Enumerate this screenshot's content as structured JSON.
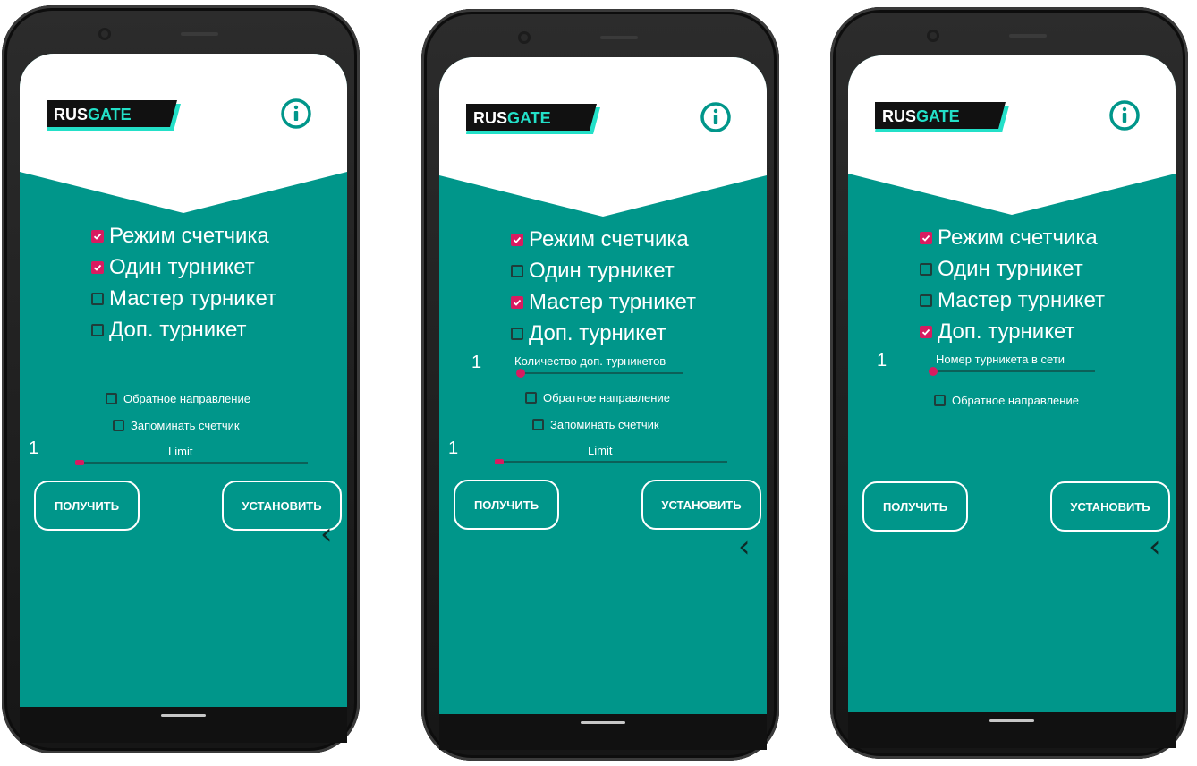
{
  "app": {
    "logo_part1": "RUS",
    "logo_part2": "GATE",
    "colors": {
      "accent": "#d81b60",
      "background": "#00968a",
      "logo_cyan": "#23e0c8"
    },
    "info_icon": "info-icon",
    "back_icon": "chevron-left-icon"
  },
  "screens": [
    {
      "modes": [
        {
          "label": "Режим счетчика",
          "checked": true
        },
        {
          "label": "Один турникет",
          "checked": true
        },
        {
          "label": "Мастер турникет",
          "checked": false
        },
        {
          "label": "Доп. турникет",
          "checked": false
        }
      ],
      "options": [
        {
          "label": "Обратное направление",
          "checked": false
        },
        {
          "label": "Запоминать счетчик",
          "checked": false
        }
      ],
      "limit": {
        "label": "Limit",
        "value": "1"
      },
      "buttons": {
        "get": "ПОЛУЧИТЬ",
        "set": "УСТАНОВИТЬ"
      },
      "back_glyph": "‹"
    },
    {
      "modes": [
        {
          "label": "Режим счетчика",
          "checked": true
        },
        {
          "label": "Один турникет",
          "checked": false
        },
        {
          "label": "Мастер турникет",
          "checked": true
        },
        {
          "label": "Доп. турникет",
          "checked": false
        }
      ],
      "extra": {
        "label": "Количество доп. турникетов",
        "value": "1"
      },
      "options": [
        {
          "label": "Обратное направление",
          "checked": false
        },
        {
          "label": "Запоминать счетчик",
          "checked": false
        }
      ],
      "limit": {
        "label": "Limit",
        "value": "1"
      },
      "buttons": {
        "get": "ПОЛУЧИТЬ",
        "set": "УСТАНОВИТЬ"
      },
      "back_glyph": "‹"
    },
    {
      "modes": [
        {
          "label": "Режим счетчика",
          "checked": true
        },
        {
          "label": "Один турникет",
          "checked": false
        },
        {
          "label": "Мастер турникет",
          "checked": false
        },
        {
          "label": "Доп. турникет",
          "checked": true
        }
      ],
      "extra": {
        "label": "Номер турникета в сети",
        "value": "1"
      },
      "options": [
        {
          "label": "Обратное направление",
          "checked": false
        }
      ],
      "buttons": {
        "get": "ПОЛУЧИТЬ",
        "set": "УСТАНОВИТЬ"
      },
      "back_glyph": "‹"
    }
  ]
}
